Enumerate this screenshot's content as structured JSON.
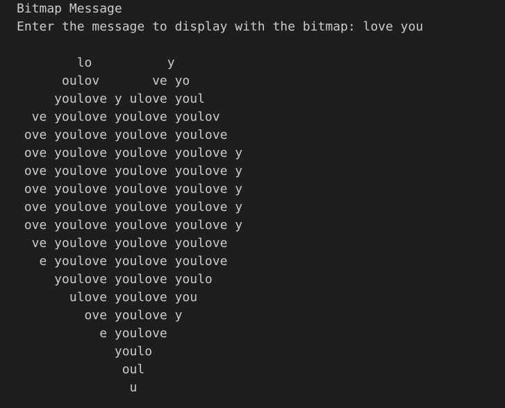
{
  "terminal": {
    "title": "Bitmap Message",
    "prompt": "Enter the message to display with the bitmap: ",
    "input": "love you"
  },
  "bitmap": {
    "lines": [
      "        lo          y",
      "      oulov       ve yo",
      "     youlove y ulove youl",
      "  ve youlove youlove youlov",
      " ove youlove youlove youlove",
      " ove youlove youlove youlove y",
      " ove youlove youlove youlove y",
      " ove youlove youlove youlove y",
      " ove youlove youlove youlove y",
      " ove youlove youlove youlove y",
      "  ve youlove youlove youlove",
      "   e youlove youlove youlove",
      "     youlove youlove youlo",
      "       ulove youlove you",
      "         ove youlove y",
      "           e youlove",
      "             youlo",
      "              oul",
      "               u"
    ]
  }
}
